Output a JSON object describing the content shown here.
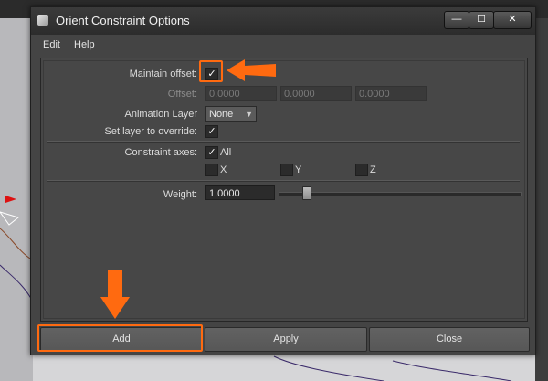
{
  "window": {
    "title": "Orient Constraint Options"
  },
  "window_buttons": {
    "minimize": "—",
    "maximize": "☐",
    "close": "✕"
  },
  "menu": [
    "Edit",
    "Help"
  ],
  "form": {
    "maintain_offset_label": "Maintain offset:",
    "maintain_offset_checked": "✓",
    "offset_label": "Offset:",
    "offset_values": [
      "0.0000",
      "0.0000",
      "0.0000"
    ],
    "animation_layer_label": "Animation Layer",
    "animation_layer_value": "None",
    "set_layer_label": "Set layer to override:",
    "set_layer_checked": "✓",
    "constraint_axes_label": "Constraint axes:",
    "axis_all_label": "All",
    "axis_all_checked": "✓",
    "axis_x_label": "X",
    "axis_y_label": "Y",
    "axis_z_label": "Z",
    "weight_label": "Weight:",
    "weight_value": "1.0000",
    "weight_slider_fraction": 0.115
  },
  "buttons": {
    "add": "Add",
    "apply": "Apply",
    "close": "Close"
  },
  "colors": {
    "annotation": "#ff6a10",
    "accent_text": "#ffffff"
  }
}
